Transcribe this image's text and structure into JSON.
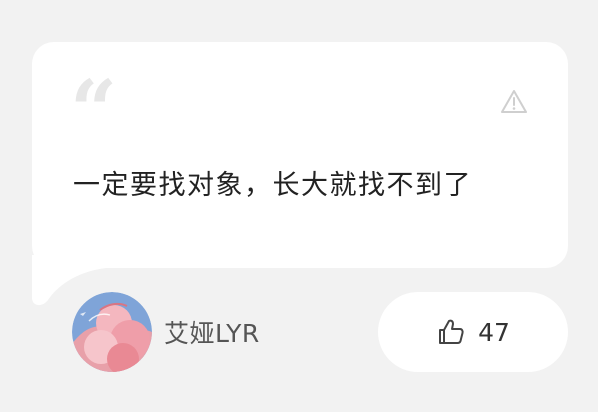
{
  "quote": {
    "mark": "“",
    "text": "一定要找对象，长大就找不到了"
  },
  "icons": {
    "quote": "quote-mark-icon",
    "report": "warning-triangle-icon",
    "like": "thumbs-up-icon"
  },
  "author": {
    "name": "艾娅LYR",
    "avatar": "pink-flower-avatar"
  },
  "likes": {
    "count": "47"
  },
  "colors": {
    "background": "#f2f2f2",
    "card": "#ffffff",
    "text": "#222222",
    "muted": "#555555",
    "quote_mark": "#e7e7e7",
    "icon": "#cccccc"
  }
}
